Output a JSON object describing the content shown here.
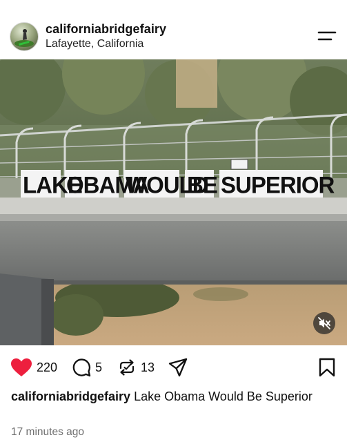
{
  "post": {
    "username": "californiabridgefairy",
    "location": "Lafayette, California"
  },
  "media": {
    "sign_words": [
      "LAKE",
      "OBAMA",
      "WOULD",
      "BE",
      "SUPERIOR"
    ],
    "muted": true
  },
  "actions": {
    "likes": "220",
    "comments": "5",
    "reposts": "13",
    "liked": true,
    "like_color": "#ed1f3e"
  },
  "caption": {
    "username": "californiabridgefairy",
    "text": "Lake Obama Would Be Superior"
  },
  "timestamp": "17 minutes ago",
  "icons": [
    "menu-icon",
    "heart-icon",
    "comment-icon",
    "repost-icon",
    "share-icon",
    "save-icon",
    "mute-icon"
  ]
}
